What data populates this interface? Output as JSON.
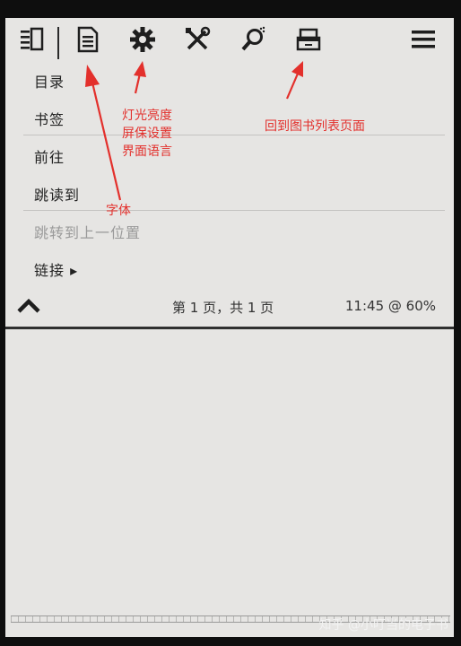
{
  "toolbar": {
    "icons": [
      "reader-menu-icon",
      "document-icon",
      "gear-icon",
      "tools-icon",
      "search-icon",
      "home-drawer-icon",
      "hamburger-icon"
    ]
  },
  "menu": {
    "items": [
      {
        "label": "目录",
        "enabled": true
      },
      {
        "label": "书签",
        "enabled": true
      },
      {
        "label": "前往",
        "enabled": true
      },
      {
        "label": "跳读到",
        "enabled": true
      },
      {
        "label": "跳转到上一位置",
        "enabled": false
      },
      {
        "label": "链接 ▸",
        "enabled": true
      }
    ]
  },
  "status": {
    "page_info": "第 1 页，共 1 页",
    "clock": "11:45 @ 60%"
  },
  "annotations": {
    "font": "字体",
    "settings": [
      "灯光亮度",
      "屏保设置",
      "界面语言"
    ],
    "back_to_library": "回到图书列表页面"
  },
  "watermark": "知乎 @小叮当的电子书",
  "colors": {
    "screen_bg": "#e6e5e3",
    "annotation_red": "#e3302c",
    "bezel": "#0e0e0e"
  }
}
